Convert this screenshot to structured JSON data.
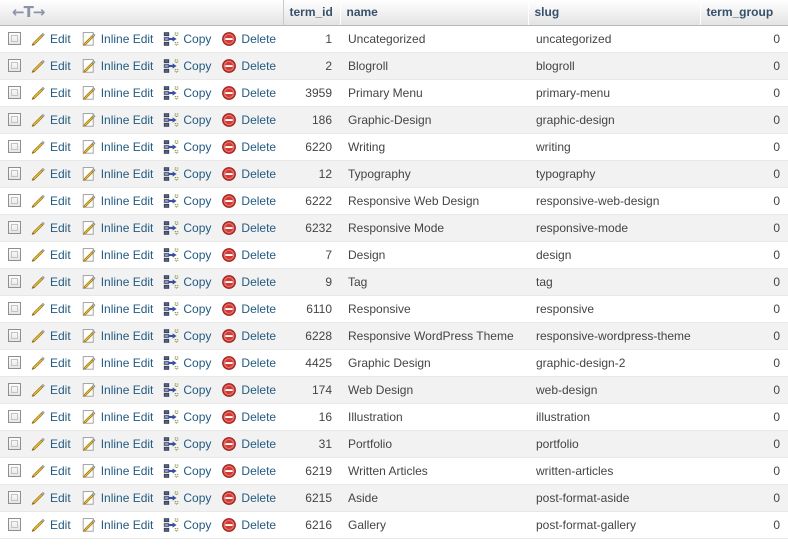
{
  "table": {
    "sort_marker": "←T→",
    "columns": [
      {
        "key": "actions",
        "label": ""
      },
      {
        "key": "term_id",
        "label": "term_id"
      },
      {
        "key": "name",
        "label": "name"
      },
      {
        "key": "slug",
        "label": "slug"
      },
      {
        "key": "term_group",
        "label": "term_group"
      }
    ],
    "row_actions": [
      {
        "name": "edit",
        "label": "Edit",
        "icon": "pencil-icon"
      },
      {
        "name": "inline-edit",
        "label": "Inline Edit",
        "icon": "pencil-page-icon"
      },
      {
        "name": "copy",
        "label": "Copy",
        "icon": "copy-icon"
      },
      {
        "name": "delete",
        "label": "Delete",
        "icon": "delete-icon"
      }
    ],
    "rows": [
      {
        "term_id": "1",
        "name": "Uncategorized",
        "slug": "uncategorized",
        "term_group": "0"
      },
      {
        "term_id": "2",
        "name": "Blogroll",
        "slug": "blogroll",
        "term_group": "0"
      },
      {
        "term_id": "3959",
        "name": "Primary Menu",
        "slug": "primary-menu",
        "term_group": "0"
      },
      {
        "term_id": "186",
        "name": "Graphic-Design",
        "slug": "graphic-design",
        "term_group": "0"
      },
      {
        "term_id": "6220",
        "name": "Writing",
        "slug": "writing",
        "term_group": "0"
      },
      {
        "term_id": "12",
        "name": "Typography",
        "slug": "typography",
        "term_group": "0"
      },
      {
        "term_id": "6222",
        "name": "Responsive Web Design",
        "slug": "responsive-web-design",
        "term_group": "0"
      },
      {
        "term_id": "6232",
        "name": "Responsive Mode",
        "slug": "responsive-mode",
        "term_group": "0"
      },
      {
        "term_id": "7",
        "name": "Design",
        "slug": "design",
        "term_group": "0"
      },
      {
        "term_id": "9",
        "name": "Tag",
        "slug": "tag",
        "term_group": "0"
      },
      {
        "term_id": "6110",
        "name": "Responsive",
        "slug": "responsive",
        "term_group": "0"
      },
      {
        "term_id": "6228",
        "name": "Responsive WordPress Theme",
        "slug": "responsive-wordpress-theme",
        "term_group": "0"
      },
      {
        "term_id": "4425",
        "name": "Graphic Design",
        "slug": "graphic-design-2",
        "term_group": "0"
      },
      {
        "term_id": "174",
        "name": "Web Design",
        "slug": "web-design",
        "term_group": "0"
      },
      {
        "term_id": "16",
        "name": "Illustration",
        "slug": "illustration",
        "term_group": "0"
      },
      {
        "term_id": "31",
        "name": "Portfolio",
        "slug": "portfolio",
        "term_group": "0"
      },
      {
        "term_id": "6219",
        "name": "Written Articles",
        "slug": "written-articles",
        "term_group": "0"
      },
      {
        "term_id": "6215",
        "name": "Aside",
        "slug": "post-format-aside",
        "term_group": "0"
      },
      {
        "term_id": "6216",
        "name": "Gallery",
        "slug": "post-format-gallery",
        "term_group": "0"
      }
    ]
  },
  "colors": {
    "header_text": "#37516b",
    "link": "#235a81",
    "row_alt": "#f2f2f2",
    "cell_text": "#444444",
    "delete_red": "#cc2222",
    "pencil_yellow": "#f5c343",
    "copy_blue": "#3b4fa0"
  }
}
